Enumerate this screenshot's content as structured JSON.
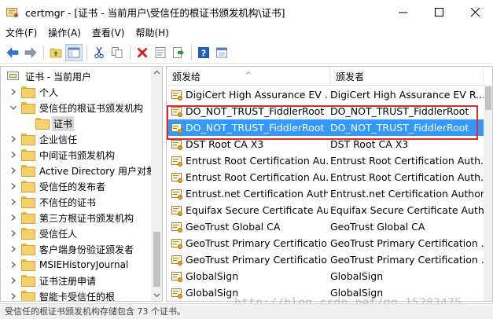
{
  "window": {
    "title": "certmgr - [证书 - 当前用户\\受信任的根证书颁发机构\\证书]",
    "minimize_label": "minimize",
    "maximize_label": "maximize",
    "close_label": "close"
  },
  "menu": {
    "file": "文件(F)",
    "action": "操作(A)",
    "view": "查看(V)",
    "help": "帮助(H)"
  },
  "toolbar": {
    "icons": [
      "back-arrow-icon",
      "forward-arrow-icon",
      "up-folder-icon",
      "show-tree-icon",
      "cut-icon",
      "copy-icon",
      "delete-icon",
      "properties-icon",
      "export-icon",
      "help-icon",
      "console-icon"
    ]
  },
  "tree": {
    "root": "证书 - 当前用户",
    "items": [
      {
        "label": "个人",
        "expanded": false
      },
      {
        "label": "受信任的根证书颁发机构",
        "expanded": true
      },
      {
        "label": "证书",
        "selected": true
      },
      {
        "label": "企业信任",
        "expanded": false
      },
      {
        "label": "中间证书颁发机构",
        "expanded": false
      },
      {
        "label": "Active Directory 用户对象",
        "expanded": false
      },
      {
        "label": "受信任的发布者",
        "expanded": false
      },
      {
        "label": "不信任的证书",
        "expanded": false
      },
      {
        "label": "第三方根证书颁发机构",
        "expanded": false
      },
      {
        "label": "受信任人",
        "expanded": false
      },
      {
        "label": "客户端身份验证颁发者",
        "expanded": false
      },
      {
        "label": "MSIEHistoryJournal",
        "expanded": false
      },
      {
        "label": "证书注册申请",
        "expanded": false
      },
      {
        "label": "智能卡受信任的根",
        "expanded": false
      }
    ]
  },
  "list": {
    "columns": {
      "issued_to": "颁发给",
      "issued_by": "颁发者"
    },
    "rows": [
      {
        "issued_to": "DigiCert High Assurance EV ...",
        "issued_by": "DigiCert High Assurance EV R..."
      },
      {
        "issued_to": "DO_NOT_TRUST_FiddlerRoot",
        "issued_by": "DO_NOT_TRUST_FiddlerRoot"
      },
      {
        "issued_to": "DO_NOT_TRUST_FiddlerRoot",
        "issued_by": "DO_NOT_TRUST_FiddlerRoot",
        "selected": true
      },
      {
        "issued_to": "DST Root CA X3",
        "issued_by": "DST Root CA X3"
      },
      {
        "issued_to": "Entrust Root Certification Au...",
        "issued_by": "Entrust Root Certification Auth..."
      },
      {
        "issued_to": "Entrust Root Certification Au...",
        "issued_by": "Entrust Root Certification Auth..."
      },
      {
        "issued_to": "Entrust.net Certification Auth...",
        "issued_by": "Entrust.net Certification Author..."
      },
      {
        "issued_to": "Equifax Secure Certificate Au...",
        "issued_by": "Equifax Secure Certificate Auth..."
      },
      {
        "issued_to": "GeoTrust Global CA",
        "issued_by": "GeoTrust Global CA"
      },
      {
        "issued_to": "GeoTrust Primary Certificatio...",
        "issued_by": "GeoTrust Primary Certification ..."
      },
      {
        "issued_to": "GeoTrust Primary Certificatio...",
        "issued_by": "GeoTrust Primary Certification ..."
      },
      {
        "issued_to": "GlobalSign",
        "issued_by": "GlobalSign"
      },
      {
        "issued_to": "GlobalSign",
        "issued_by": "GlobalSign"
      }
    ]
  },
  "status": {
    "text": "受信任的根证书颁发机构存储包含 73 个证书。"
  },
  "watermark": "http://blog.csdn.net/qq_15283475",
  "colors": {
    "selection": "#3399ff",
    "highlight_box": "#e0282c"
  }
}
